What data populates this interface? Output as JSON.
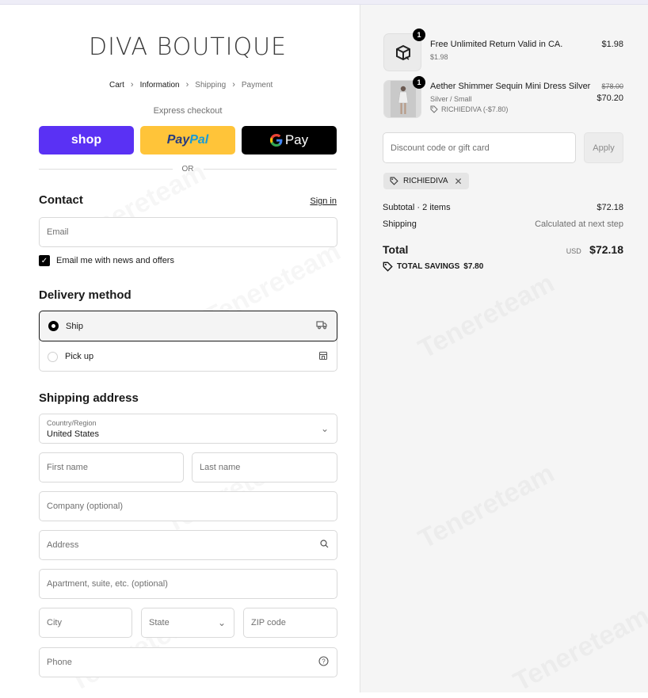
{
  "header": {
    "brand": "DIVA BOUTIQUE",
    "breadcrumbs": [
      "Cart",
      "Information",
      "Shipping",
      "Payment"
    ]
  },
  "express": {
    "title": "Express checkout",
    "shop_label": "shop",
    "paypal_label_1": "Pay",
    "paypal_label_2": "Pal",
    "gpay_label": "Pay",
    "or_label": "OR"
  },
  "contact": {
    "title": "Contact",
    "sign_in": "Sign in",
    "email_placeholder": "Email",
    "newsletter_label": "Email me with news and offers",
    "newsletter_checked": true
  },
  "delivery": {
    "title": "Delivery method",
    "options": [
      {
        "label": "Ship",
        "selected": true
      },
      {
        "label": "Pick up",
        "selected": false
      }
    ]
  },
  "shipping": {
    "title": "Shipping address",
    "country_label": "Country/Region",
    "country_value": "United States",
    "first_name": "First name",
    "last_name": "Last name",
    "company": "Company (optional)",
    "address": "Address",
    "apartment": "Apartment, suite, etc. (optional)",
    "city": "City",
    "state": "State",
    "zip": "ZIP code",
    "phone": "Phone"
  },
  "order": {
    "items": [
      {
        "qty": "1",
        "title": "Free Unlimited Return Valid in CA.",
        "sub": "$1.98",
        "price": "$1.98"
      },
      {
        "qty": "1",
        "title": "Aether Shimmer Sequin Mini Dress Silver",
        "sub": "Silver / Small",
        "discount": "RICHIEDIVA (-$7.80)",
        "old_price": "$78.00",
        "price": "$70.20"
      }
    ],
    "discount_placeholder": "Discount code or gift card",
    "apply_label": "Apply",
    "applied_code": "RICHIEDIVA",
    "subtotal_label": "Subtotal · 2 items",
    "subtotal_value": "$72.18",
    "shipping_label": "Shipping",
    "shipping_value": "Calculated at next step",
    "total_label": "Total",
    "currency": "USD",
    "total_value": "$72.18",
    "savings_label": "TOTAL SAVINGS",
    "savings_value": "$7.80"
  },
  "watermark_text": "Tenereteam",
  "colors": {
    "shop_purple": "#5a31f4",
    "paypal_yellow": "#ffc439",
    "right_panel_bg": "#f5f5f5"
  }
}
